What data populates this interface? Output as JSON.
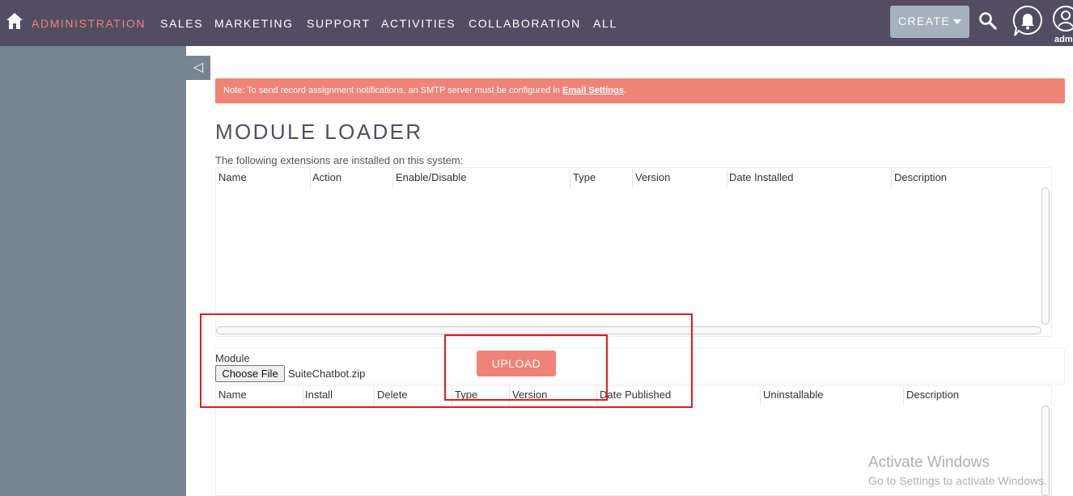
{
  "nav": {
    "items": [
      "ADMINISTRATION",
      "SALES",
      "MARKETING",
      "SUPPORT",
      "ACTIVITIES",
      "COLLABORATION",
      "ALL"
    ],
    "create_label": "CREATE",
    "user_label": "adm"
  },
  "sidebar": {
    "collapse_glyph": "◁"
  },
  "notice": {
    "text": "Note: To send record assignment notifications, an SMTP server must be configured in ",
    "link": "Email Settings",
    "suffix": "."
  },
  "page": {
    "title": "MODULE LOADER",
    "intro": "The following extensions are installed on this system:"
  },
  "installed_table": {
    "columns": [
      "Name",
      "Action",
      "Enable/Disable",
      "Type",
      "Version",
      "Date Installed",
      "Description"
    ]
  },
  "upload_form": {
    "module_label": "Module",
    "choose_file_label": "Choose File",
    "file_name": "SuiteChatbot.zip",
    "upload_label": "UPLOAD"
  },
  "packages_table": {
    "columns": [
      "Name",
      "Install",
      "Delete",
      "Type",
      "Version",
      "Date Published",
      "Uninstallable",
      "Description"
    ]
  },
  "watermark": {
    "line1": "Activate Windows",
    "line2": "Go to Settings to activate Windows."
  },
  "colors": {
    "nav_bg": "#534d64",
    "accent": "#f08377",
    "sidebar_bg": "#778591",
    "highlight_box": "#e41b1b"
  },
  "icons": [
    "home-icon",
    "search-icon",
    "bell-icon",
    "user-icon",
    "caret-down-icon",
    "collapse-arrow-icon"
  ]
}
